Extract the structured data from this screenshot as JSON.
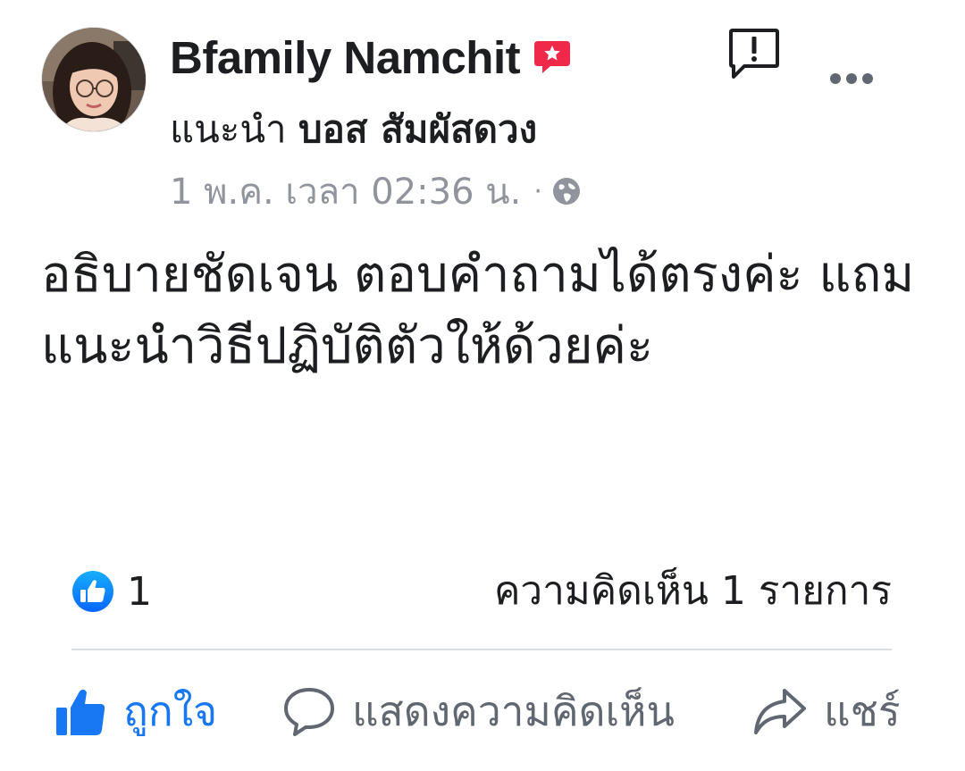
{
  "post": {
    "author": {
      "name": "Bfamily Namchit",
      "badge_icon": "star-badge-icon",
      "badge_color": "#f02849",
      "avatar_icon": "profile-photo-avatar"
    },
    "recommend": {
      "prefix": "แนะนำ",
      "page_name": "บอส สัมผัสดวง"
    },
    "meta": {
      "timestamp": "1 พ.ค. เวลา 02:36 น.",
      "separator": "·",
      "privacy_icon": "globe-icon"
    },
    "header_actions": {
      "report_icon": "report-icon",
      "more_icon": "more-options-icon"
    },
    "text": "อธิบายชัดเจน ตอบคำถามได้ตรงค่ะ แถมแนะนำวิธีปฏิบัติตัวให้ด้วยค่ะ",
    "reactions": {
      "like_icon": "like-badge-icon",
      "like_count": "1",
      "comment_count_text": "ความคิดเห็น 1 รายการ"
    },
    "actions": {
      "like_label": "ถูกใจ",
      "comment_label": "แสดงความคิดเห็น",
      "share_label": "แชร์"
    },
    "colors": {
      "accent": "#1877f2",
      "text": "#1c1e21",
      "secondary": "#606770",
      "meta": "#90949c"
    }
  }
}
